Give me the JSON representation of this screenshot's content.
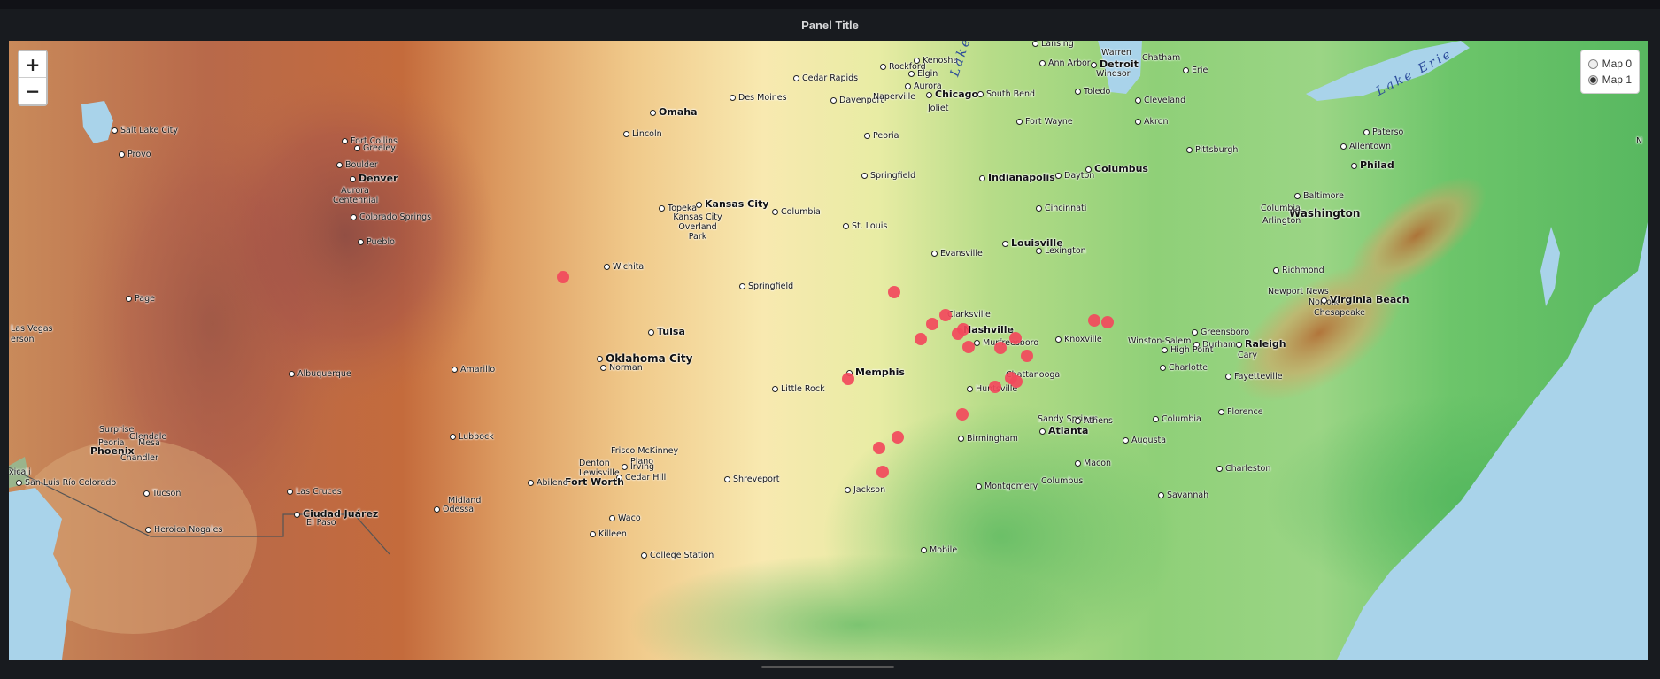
{
  "panel": {
    "title": "Panel Title"
  },
  "zoom": {
    "in_label": "+",
    "out_label": "−"
  },
  "layers": [
    {
      "label": "Map 0",
      "selected": false
    },
    {
      "label": "Map 1",
      "selected": true
    }
  ],
  "lake_labels": [
    "Lake",
    "Lake Erie"
  ],
  "colors": {
    "marker": "#f2495c",
    "panel_bg": "#181b1f",
    "water": "#a9d3ea"
  },
  "cities": [
    "Salt Lake City",
    "Provo",
    "Fort Collins",
    "Greeley",
    "Boulder",
    "Denver",
    "Aurora Centennial",
    "Colorado Springs",
    "Pueblo",
    "Page",
    "Las Vegas",
    "erson",
    "Albuquerque",
    "Surprise",
    "Glendale",
    "Peoria",
    "Mesa",
    "Phoenix",
    "Chandler",
    "xicali",
    "San Luis Río Colorado",
    "Tucson",
    "Heroica Nogales",
    "Las Cruces",
    "Ciudad Juárez",
    "El Paso",
    "Omaha",
    "Lincoln",
    "Des Moines",
    "Cedar Rapids",
    "Davenport",
    "Rockford",
    "Kenosha",
    "Elgin",
    "Aurora",
    "Naperville",
    "Chicago",
    "Joliet",
    "Peoria",
    "Springfield",
    "Lansing",
    "Ann Arbor",
    "Warren",
    "Detroit",
    "Windsor",
    "Chatham",
    "Toledo",
    "Erie",
    "South Bend",
    "Cleveland",
    "Akron",
    "Fort Wayne",
    "Pittsburgh",
    "Indianapolis",
    "Dayton",
    "Columbus",
    "Cincinnati",
    "Topeka",
    "Kansas City",
    "Kansas City Overland Park",
    "Columbia",
    "St. Louis",
    "Louisville",
    "Lexington",
    "Evansville",
    "Wichita",
    "Springfield",
    "Clarksville",
    "Nashville",
    "Murfreesboro",
    "Knoxville",
    "Tulsa",
    "Oklahoma City",
    "Norman",
    "Amarillo",
    "Little Rock",
    "Memphis",
    "Huntsville",
    "Chattanooga",
    "Lubbock",
    "Frisco McKinney",
    "Plano",
    "Denton Lewisville",
    "Irving",
    "Cedar Hill",
    "Fort Worth",
    "Abilene",
    "Midland",
    "Odessa",
    "Shreveport",
    "Jackson",
    "Birmingham",
    "Sandy Springs",
    "Atlanta",
    "Athens",
    "Augusta",
    "Columbia",
    "Florence",
    "Charleston",
    "Savannah",
    "Macon",
    "Montgomery",
    "Columbus",
    "Waco",
    "Killeen",
    "College Station",
    "Mobile",
    "Charlotte",
    "Fayetteville",
    "Winston-Salem",
    "Greensboro",
    "Durham",
    "High Point",
    "Raleigh",
    "Cary",
    "Richmond",
    "Newport News",
    "Norfolk",
    "Chesapeake",
    "Virginia Beach",
    "Washington",
    "Baltimore",
    "Columbia",
    "Arlington",
    "Allentown",
    "Philad",
    "Paterso",
    "N"
  ],
  "marker_count": 26
}
